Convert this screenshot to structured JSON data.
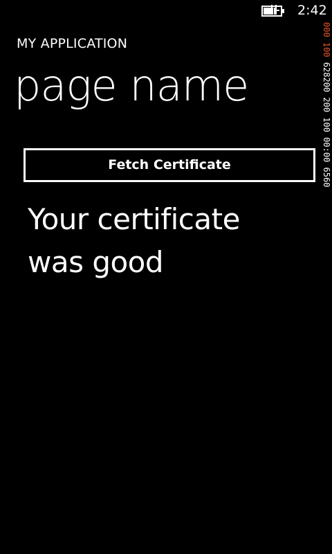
{
  "status_bar": {
    "time": "2:42",
    "battery_icon": "battery-charging-icon"
  },
  "debug_counter": {
    "hot_segment": "000 100",
    "normal_segment": "628200 200 100 00:00 6560"
  },
  "app": {
    "title": "MY APPLICATION",
    "page_name": "page name"
  },
  "actions": {
    "fetch_label": "Fetch Certificate"
  },
  "result": {
    "message": "Your certificate was good"
  },
  "colors": {
    "background": "#000000",
    "foreground": "#ffffff",
    "counter_accent": "#e8552a"
  }
}
